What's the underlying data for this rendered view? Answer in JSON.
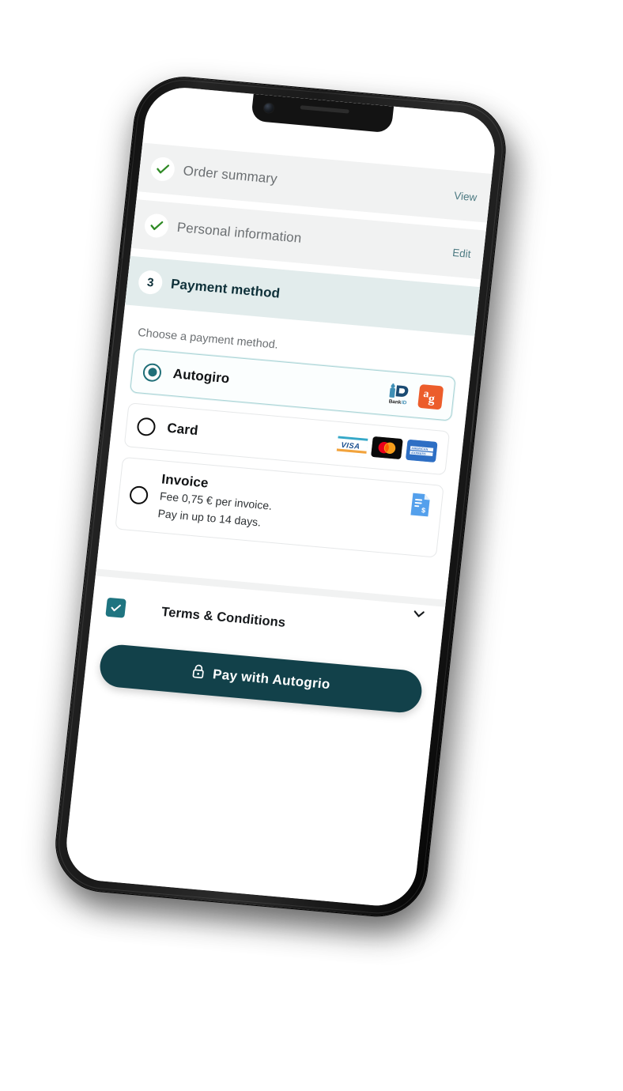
{
  "device": {
    "type": "smartphone-mockup",
    "notch": true,
    "camera_icon": "front-camera",
    "speaker": "earpiece-speaker"
  },
  "checkout": {
    "steps": [
      {
        "id": "order-summary",
        "label": "Order summary",
        "state": "complete",
        "icon": "check-icon",
        "action": "View"
      },
      {
        "id": "personal-information",
        "label": "Personal information",
        "state": "complete",
        "icon": "check-icon",
        "action": "Edit"
      },
      {
        "id": "payment-method",
        "label": "Payment method",
        "state": "active",
        "number": "3",
        "action": ""
      }
    ],
    "prompt": "Choose a payment method.",
    "payment_methods": [
      {
        "id": "autogiro",
        "title": "Autogiro",
        "subtitle": "",
        "selected": true,
        "logos": [
          "bankid-logo",
          "autogiro-ag-logo"
        ],
        "logo_labels": [
          "BankID",
          "ag"
        ]
      },
      {
        "id": "card",
        "title": "Card",
        "subtitle": "",
        "selected": false,
        "logos": [
          "visa-logo",
          "mastercard-logo",
          "amex-logo"
        ],
        "logo_labels": [
          "VISA",
          "",
          "AMERICAN EXPRESS"
        ]
      },
      {
        "id": "invoice",
        "title": "Invoice",
        "subtitle_line1": "Fee 0,75 € per invoice.",
        "subtitle_line2": "Pay in up to 14 days.",
        "selected": false,
        "logos": [
          "invoice-document-icon"
        ],
        "logo_labels": [
          ""
        ]
      }
    ],
    "terms": {
      "label": "Terms & Conditions",
      "checked": true,
      "expand_icon": "chevron-down-icon"
    },
    "pay_button": {
      "label": "Pay with Autogrio",
      "icon": "lock-icon"
    }
  },
  "colors": {
    "step_complete_bg": "#f1f2f2",
    "step_active_bg": "#e2ecec",
    "step_active_text": "#0e3039",
    "link": "#4e7b83",
    "check_green": "#2f8a25",
    "accent_teal": "#206f78",
    "checkbox_teal": "#1f7480",
    "pay_button_bg": "#12414a",
    "selected_card_border": "#a9d4d6",
    "autogiro_orange": "#ec5d2b",
    "bankid_blue": "#1a4b73",
    "visa_blue": "#1a4f8f",
    "amex_blue": "#2e6fc4",
    "invoice_icon_blue": "#54a0ec"
  }
}
